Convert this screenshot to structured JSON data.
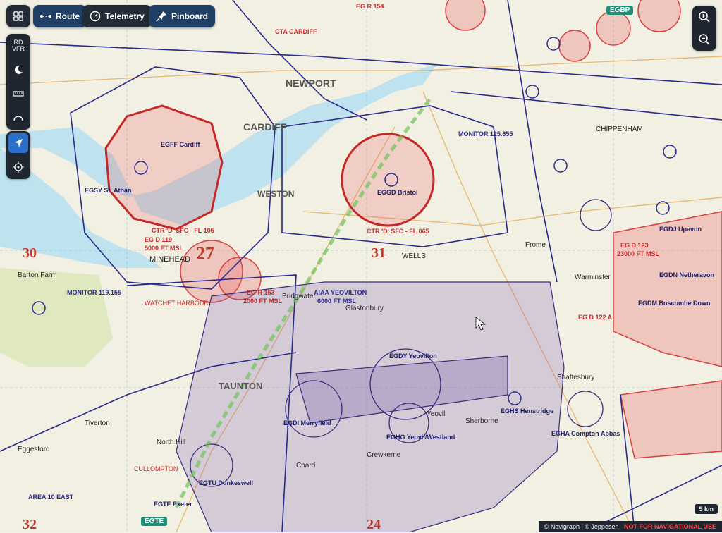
{
  "toolbar": {
    "route_label": "Route",
    "telemetry_label": "Telemetry",
    "pinboard_label": "Pinboard"
  },
  "sidebar": {
    "chart_type_line1": "RD",
    "chart_type_line2": "VFR"
  },
  "map": {
    "grid_numbers": [
      "30",
      "27",
      "31",
      "32",
      "24"
    ],
    "airspace_labels": {
      "egr154": "EG R 154",
      "cta_cardiff": "CTA CARDIFF",
      "egd119": "EG D 119",
      "egd119_alt": "5000 FT MSL",
      "egr153": "EG R 153",
      "egr153_alt": "2000 FT MSL",
      "egd123": "EG D 123",
      "egd123_alt": "23000 FT MSL",
      "egd122": "EG D 122 A",
      "ctr_cardiff": "CTR 'D' SFC - FL 105",
      "ctr_bristol": "CTR 'D' SFC - FL 065",
      "aiaa_yeovilton": "AIAA YEOVILTON",
      "aiaa_yeovilton_alt": "6000 FT MSL",
      "area10_east": "AREA 10 EAST",
      "monitor_cardiff": "MONITOR 119.155",
      "monitor_bristol": "MONITOR 125.655"
    },
    "airports": {
      "cardiff": "EGFF Cardiff",
      "bristol": "EGGD Bristol",
      "yeovilton": "EGDY Yeovilton",
      "merryfield": "EGDI Merryfield",
      "yeovil": "EGHG Yeovil/Westland",
      "henstridge": "EGHS Henstridge",
      "compton": "EGHA Compton Abbas",
      "dunkeswell": "EGTU Dunkeswell",
      "exeter": "EGTE Exeter",
      "boscombe": "EGDM Boscombe Down",
      "netheravon": "EGDN Netheravon",
      "upavon": "EGDJ Upavon",
      "st_athan": "EGSY St. Athan"
    },
    "towns": {
      "cardiff": "CARDIFF",
      "newport": "NEWPORT",
      "weston": "WESTON",
      "minehead": "MINEHEAD",
      "taunton": "TAUNTON",
      "chard": "Chard",
      "sherborne": "Sherborne",
      "shaftesbury": "Shaftesbury",
      "warminster": "Warminster",
      "chippenham": "CHIPPENHAM",
      "crewkerne": "Crewkerne",
      "frome": "Frome",
      "wells": "WELLS",
      "glastonbury": "Glastonbury",
      "bridgwater": "Bridgwater",
      "watchet": "WATCHET HARBOUR",
      "barton_farm": "Barton Farm",
      "eggesford": "Eggesford",
      "north_hill": "North Hill",
      "yeovil": "Yeovil",
      "cullompton": "CULLOMPTON",
      "tiverton": "Tiverton"
    },
    "badges": {
      "egbp": "EGBP",
      "egte": "EGTE"
    }
  },
  "scale": {
    "label": "5 km"
  },
  "attribution": {
    "text": "© Navigraph | © Jeppesen",
    "warning": "NOT FOR NAVIGATIONAL USE"
  },
  "colors": {
    "accent": "#1f3f66",
    "restricted": "#e04a4a",
    "airspace": "#2a2a8a",
    "mata": "#7a5fb0"
  }
}
